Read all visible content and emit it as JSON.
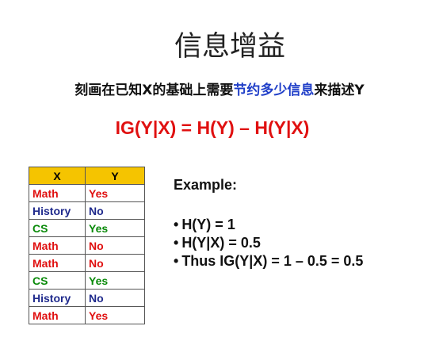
{
  "title": "信息增益",
  "subtitle": {
    "before": "刻画在已知X的基础上需要",
    "highlight": "节约多少信息",
    "after": "来描述Y"
  },
  "formula": "IG(Y|X) = H(Y) – H(Y|X)",
  "table": {
    "headers": [
      "X",
      "Y"
    ],
    "rows": [
      {
        "x": "Math",
        "y": "Yes"
      },
      {
        "x": "History",
        "y": "No"
      },
      {
        "x": "CS",
        "y": "Yes"
      },
      {
        "x": "Math",
        "y": "No"
      },
      {
        "x": "Math",
        "y": "No"
      },
      {
        "x": "CS",
        "y": "Yes"
      },
      {
        "x": "History",
        "y": "No"
      },
      {
        "x": "Math",
        "y": "Yes"
      }
    ]
  },
  "example": {
    "heading": "Example:",
    "bullets": [
      "H(Y) = 1",
      "H(Y|X) = 0.5",
      "Thus IG(Y|X) = 1 – 0.5 = 0.5"
    ]
  },
  "colors": {
    "Math": "#e01010",
    "History": "#1f2a8c",
    "CS": "#0a8a0a",
    "Yes": "#e01010",
    "No": "#1f2a8c",
    "yes_after_cs": "#0a8a0a",
    "highlight": "#1f3ec8",
    "header_bg": "#f5c400"
  }
}
